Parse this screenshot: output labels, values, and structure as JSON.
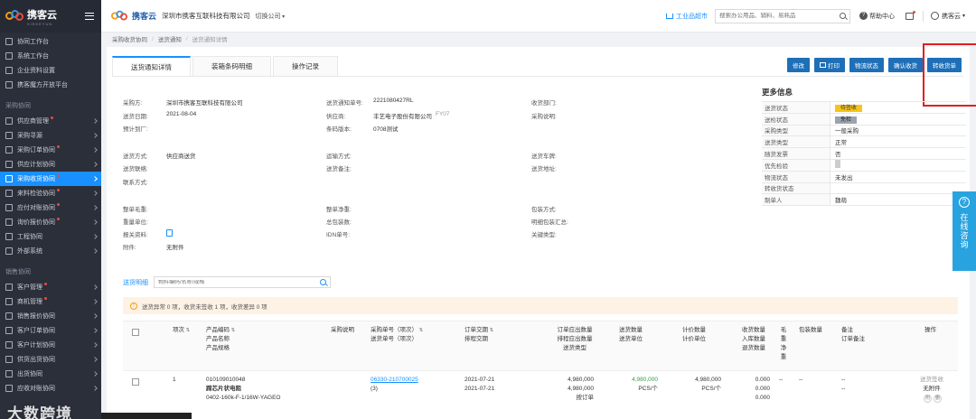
{
  "brand": {
    "name": "携客云",
    "sub": "XIEKEYUN"
  },
  "sidebar": {
    "top_items": [
      {
        "label": "协同工作台"
      },
      {
        "label": "系统工作台"
      },
      {
        "label": "企业资料设置"
      },
      {
        "label": "携客魔方开放平台"
      }
    ],
    "section_purchase": "采购协同",
    "purchase_items": [
      {
        "label": "供应商管理",
        "dot": true
      },
      {
        "label": "采购寻源",
        "dot": false
      },
      {
        "label": "采购订单协同",
        "dot": true
      },
      {
        "label": "供应计划协同",
        "dot": false
      },
      {
        "label": "采购收货协同",
        "dot": true,
        "active": true
      },
      {
        "label": "来料检验协同",
        "dot": true
      },
      {
        "label": "应付对账协同",
        "dot": true
      },
      {
        "label": "询价报价协同",
        "dot": true
      },
      {
        "label": "工程协同",
        "dot": false
      },
      {
        "label": "外部系统",
        "dot": false
      }
    ],
    "section_sales": "销售协同",
    "sales_items": [
      {
        "label": "客户管理",
        "dot": true
      },
      {
        "label": "商机管理",
        "dot": true
      },
      {
        "label": "销售报价协同",
        "dot": false
      },
      {
        "label": "客户订单协同",
        "dot": false
      },
      {
        "label": "客户计划协同",
        "dot": false
      },
      {
        "label": "供货出货协同",
        "dot": false
      },
      {
        "label": "出货协同",
        "dot": false
      },
      {
        "label": "应收对账协同",
        "dot": false
      }
    ]
  },
  "header": {
    "logo_text": "携客云",
    "company": "深圳市携客互联科技有限公司",
    "switch_label": "切换公司",
    "mall_label": "工业品超市",
    "search_placeholder": "搜索办公用品、辅料、易耗品",
    "help_label": "帮助中心",
    "user_label": "携客云"
  },
  "breadcrumb": [
    "采购收货协同",
    "送货通知",
    "送货通知详情"
  ],
  "tabs": [
    "送货通知详情",
    "装箱条码明细",
    "操作记录"
  ],
  "actions": {
    "edit": "修改",
    "print": "打印",
    "logistics": "物流状态",
    "confirm": "确认收货",
    "transfer": "转收货单"
  },
  "info": {
    "purchaser_k": "采购方:",
    "purchaser_v": "深圳市携客互联科技有限公司",
    "notice_no_k": "送货通知单号:",
    "notice_no_v": "2221080427RL",
    "recv_dept_k": "收货部门:",
    "recv_dept_v": "",
    "date_k": "送货日期:",
    "date_v": "2021-08-04",
    "supplier_k": "供应商:",
    "supplier_v": "丰艺电子股份有限公司",
    "supplier_code": "FY07",
    "remark_k": "采购说明:",
    "remark_v": "",
    "plant_k": "预计到厂:",
    "plant_v": "",
    "barcode_k": "条码版本:",
    "barcode_v": "0708测试",
    "method_k": "送货方式:",
    "method_v": "供应商送货",
    "transport_k": "运输方式:",
    "transport_v": "",
    "plate_k": "送货车牌:",
    "plate_v": "",
    "contact_k": "送货联络:",
    "contact_v": "",
    "remark2_k": "送货备注:",
    "remark2_v": "",
    "addr_k": "送货地址:",
    "addr_v": "",
    "phone_k": "联系方式:",
    "phone_v": "",
    "gross_k": "整单毛重:",
    "gross_v": "",
    "net_k": "整单净重:",
    "net_v": "",
    "pack_k": "包装方式:",
    "pack_v": "",
    "unit_k": "重量单位:",
    "unit_v": "",
    "boxes_k": "总包装数:",
    "boxes_v": "",
    "pkgsum_k": "明细包装汇总:",
    "pkgsum_v": "",
    "report_k": "报关资料:",
    "idn_k": "IDN单号:",
    "idn_v": "",
    "kind_k": "关键类型:",
    "kind_v": "",
    "attach_k": "附件:",
    "attach_v": "无附件"
  },
  "more_info": {
    "title": "更多信息",
    "rows": [
      {
        "k": "送货状态",
        "v": "待签收",
        "type": "yellow"
      },
      {
        "k": "送检状态",
        "v": "免检",
        "type": "gray"
      },
      {
        "k": "采购类型",
        "v": "一般采购",
        "type": "text"
      },
      {
        "k": "送货类型",
        "v": "正常",
        "type": "text"
      },
      {
        "k": "随货发票",
        "v": "否",
        "type": "text"
      },
      {
        "k": "优先检验",
        "v": "",
        "type": "square"
      },
      {
        "k": "物流状态",
        "v": "未发出",
        "type": "text"
      },
      {
        "k": "转收货状态",
        "v": "",
        "type": "text"
      },
      {
        "k": "制单人",
        "v": "魏萌",
        "type": "text"
      }
    ]
  },
  "detail": {
    "label": "送货明细",
    "search_placeholder": "物料编码/名称/规格",
    "warning": "送货异常 0 项，收货未签收 1 项，收货差异 0 项"
  },
  "table": {
    "headers": {
      "item_no": "项次",
      "product": [
        "产品编码",
        "产品名称",
        "产品规格"
      ],
      "purchase_remark": "采购说明",
      "order_no": [
        "采购单号（项次）",
        "送货单号（项次）"
      ],
      "order_dates": [
        "订单交期",
        "排程交期"
      ],
      "order_qty": [
        "订单应出数量",
        "排程应出数量",
        "送货类型"
      ],
      "delivery_qty": [
        "送货数量",
        "送货单位"
      ],
      "price_qty": [
        "计价数量",
        "计价单位"
      ],
      "recv_qty": [
        "收货数量",
        "入库数量",
        "退货数量"
      ],
      "gross": [
        "毛",
        "重",
        "净",
        "重"
      ],
      "pack_qty": "包装数量",
      "remark": [
        "备注",
        "订单备注"
      ],
      "op": "操作"
    },
    "row": {
      "item_no": "1",
      "code": "010109010048",
      "name": "蹄芯片状电阻",
      "spec": "0402-160k-F-1/16W-YAGEO",
      "order_no": "06330-210700025",
      "order_sub": "(3)",
      "date1": "2021-07-21",
      "date2": "2021-07-21",
      "qty1": "4,980,000",
      "qty2": "4,980,000",
      "qty_type": "按订单",
      "dq": "4,980,000",
      "du": "PCS/个",
      "pq": "4,980,000",
      "pu": "PCS/个",
      "rq1": "0.000",
      "rq2": "0.000",
      "rq3": "0.000",
      "gross": "--",
      "pack": "--",
      "remark1": "--",
      "remark2": "--",
      "op_status": "送货签收",
      "op_attach": "无附件",
      "op_btn1": "附",
      "op_btn2": "删"
    }
  },
  "consult": {
    "label": "在线咨询"
  },
  "watermark": "大数跨境"
}
